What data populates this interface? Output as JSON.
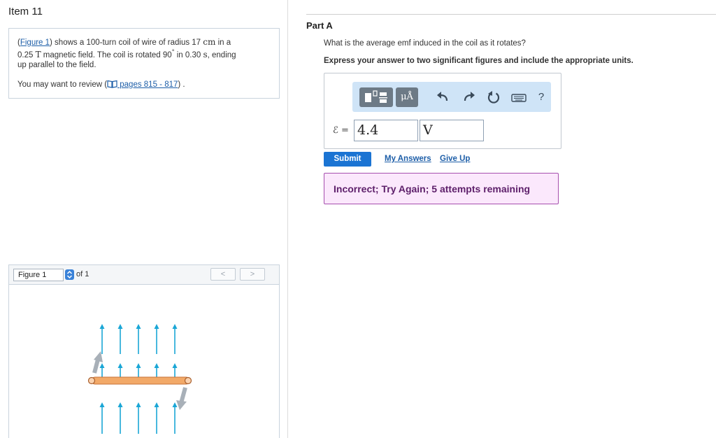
{
  "item": {
    "title": "Item 11"
  },
  "problem": {
    "figure_link": "Figure 1",
    "text_1": ") shows a 100-turn coil of wire of radius 17 ",
    "unit_cm": "cm",
    "text_2": " in a",
    "text_3": "0.25 ",
    "unit_T": "T",
    "text_4": " magnetic field. The coil is rotated 90",
    "degree": "°",
    "text_5": " in 0.30 ",
    "unit_s": "s",
    "text_6": ", ending",
    "text_7": "up parallel to the field.",
    "review_prefix": "You may want to review (",
    "review_link": " pages 815 - 817",
    "review_suffix": ") ."
  },
  "figure": {
    "select_value": "Figure 1",
    "of_label": "of 1",
    "prev": "<",
    "next": ">"
  },
  "part": {
    "title": "Part A",
    "question": "What is the average emf induced in the coil as it rotates?",
    "instruction": "Express your answer to two significant figures and include the appropriate units."
  },
  "toolbar": {
    "units_label": "μÅ",
    "help_label": "?"
  },
  "answer": {
    "emf_label": "ℰ =",
    "value": "4.4",
    "units": "V"
  },
  "actions": {
    "submit": "Submit",
    "my_answers": "My Answers",
    "give_up": "Give Up"
  },
  "feedback": {
    "text": "Incorrect; Try Again; 5 attempts remaining"
  },
  "colors": {
    "field_arrow": "#1aa6d6",
    "coil": "#f2a968",
    "submit": "#1b74d3",
    "feedback_border": "#a64fae",
    "feedback_bg": "#fbe8fc"
  }
}
